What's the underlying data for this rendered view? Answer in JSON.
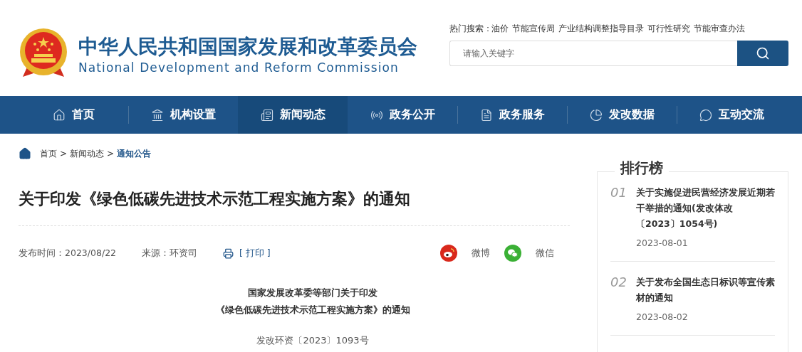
{
  "header": {
    "title_cn": "中华人民共和国国家发展和改革委员会",
    "title_en": "National Development and Reform Commission",
    "hot_search": {
      "label": "热门搜索：",
      "links": [
        "油价",
        "节能宣传周",
        "产业结构调整指导目录",
        "可行性研究",
        "节能审查办法"
      ]
    },
    "search": {
      "placeholder": "请输入关键字"
    }
  },
  "nav": [
    {
      "label": "首页",
      "selected": false
    },
    {
      "label": "机构设置",
      "selected": false
    },
    {
      "label": "新闻动态",
      "selected": true
    },
    {
      "label": "政务公开",
      "selected": false
    },
    {
      "label": "政务服务",
      "selected": false
    },
    {
      "label": "发改数据",
      "selected": false
    },
    {
      "label": "互动交流",
      "selected": false
    }
  ],
  "breadcrumb": [
    {
      "kind": "link",
      "label": "首页",
      "current": false
    },
    {
      "kind": "separator",
      "label": ">"
    },
    {
      "kind": "link",
      "label": "新闻动态",
      "current": false
    },
    {
      "kind": "separator",
      "label": ">"
    },
    {
      "kind": "link",
      "label": "通知公告",
      "current": true
    }
  ],
  "article": {
    "title": "关于印发《绿色低碳先进技术示范工程实施方案》的通知",
    "published": "发布时间：2023/08/22",
    "source": "来源：环资司",
    "print": "[ 打印 ]",
    "share": [
      {
        "label": "微博",
        "kind": "weibo"
      },
      {
        "label": "微信",
        "kind": "wechat"
      }
    ],
    "heading_lines": [
      "国家发展改革委等部门关于印发",
      "《绿色低碳先进技术示范工程实施方案》的通知"
    ],
    "doc_number": "发改环资〔2023〕1093号"
  },
  "ranking": {
    "title": "排行榜",
    "items": [
      {
        "rank": "01",
        "title": "关于实施促进民营经济发展近期若干举措的通知(发改体改〔2023〕1054号)",
        "date": "2023-08-01"
      },
      {
        "rank": "02",
        "title": "关于发布全国生态日标识等宣传素材的通知",
        "date": "2023-08-02"
      }
    ]
  }
}
